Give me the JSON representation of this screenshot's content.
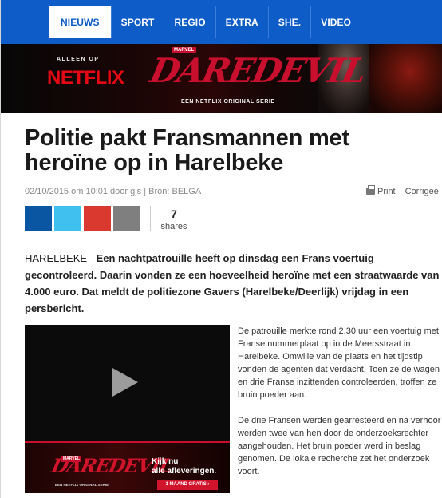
{
  "nav": {
    "tabs": [
      {
        "label": "NIEUWS",
        "active": true
      },
      {
        "label": "SPORT",
        "active": false
      },
      {
        "label": "REGIO",
        "active": false
      },
      {
        "label": "EXTRA",
        "active": false
      },
      {
        "label": "SHE.",
        "active": false
      },
      {
        "label": "VIDEO",
        "active": false
      }
    ]
  },
  "banner": {
    "tagline": "ALLEEN OP",
    "brand": "NETFLIX",
    "marvel": "MARVEL",
    "title": "DAREDEVIL",
    "subtitle": "EEN NETFLIX ORIGINAL SERIE"
  },
  "article": {
    "headline": "Politie pakt Fransmannen met heroïne op in Harelbeke",
    "meta_date": "02/10/2015 om 10:01 door ",
    "meta_author": "gjs",
    "meta_source": " | Bron: BELGA",
    "print_label": "Print",
    "correction_label": "Corrigee",
    "share_count": "7",
    "share_label": "shares",
    "lead_place": "HARELBEKE - ",
    "lead_text": "Een nachtpatrouille heeft op dinsdag een Frans voertuig gecontroleerd. Daarin vonden ze een hoeveelheid heroïne met een straatwaarde van 4.000 euro. Dat meldt de politiezone Gavers (Harelbeke/Deerlijk) vrijdag in een persbericht.",
    "paragraph1": "De patrouille merkte rond 2.30 uur een voertuig met Franse nummerplaat op in de Meersstraat in Harelbeke. Omwille van de plaats en het tijdstip vonden de agenten dat verdacht. Toen ze de wagen en drie Franse inzittenden controleerden, troffen ze bruin poeder aan.",
    "paragraph2": "De drie Fransen werden gearresteerd en na verhoor werden twee van hen door de onderzoeksrechter aangehouden. Het bruin poeder werd in beslag genomen. De lokale recherche zet het onderzoek voort."
  },
  "video_ad": {
    "marvel": "MARVEL",
    "title": "DAREDEVIL",
    "subtitle": "EEN NETFLIX ORIGINAL SERIE",
    "line1": "Kijk nu",
    "line2": "alle afleveringen.",
    "cta": "1 MAAND GRATIS ›"
  }
}
